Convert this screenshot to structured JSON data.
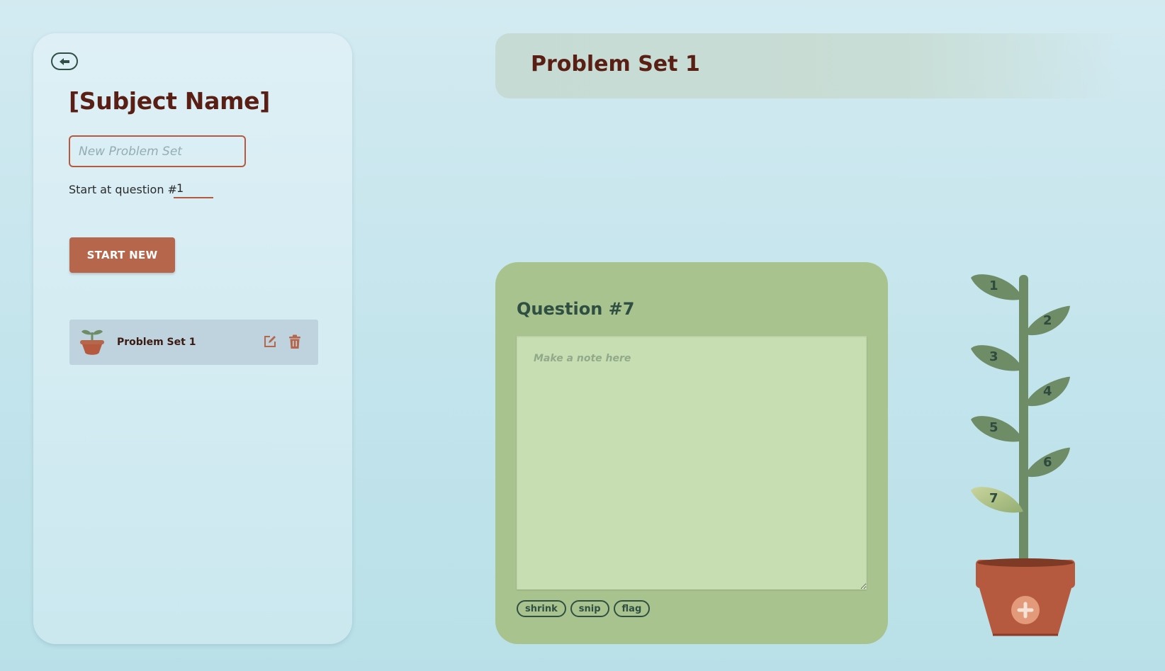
{
  "sidebar": {
    "subject_title": "[Subject Name]",
    "new_problem_set_placeholder": "New Problem Set",
    "start_at_label": "Start at question #",
    "start_at_value": "1",
    "start_button_label": "START NEW",
    "problem_sets": [
      {
        "name": "Problem Set 1"
      }
    ]
  },
  "header": {
    "title": "Problem Set 1"
  },
  "question": {
    "title": "Question #7",
    "note_placeholder": "Make a note here",
    "tags": [
      "shrink",
      "snip",
      "flag"
    ]
  },
  "plant": {
    "leaves": [
      "1",
      "2",
      "3",
      "4",
      "5",
      "6",
      "7"
    ],
    "current_leaf": "7"
  },
  "colors": {
    "accent": "#b5664b",
    "title": "#5a1f14",
    "leaf": "#6e8c65",
    "leaf_current": "#b9c98e",
    "card": "#a9c38f"
  }
}
